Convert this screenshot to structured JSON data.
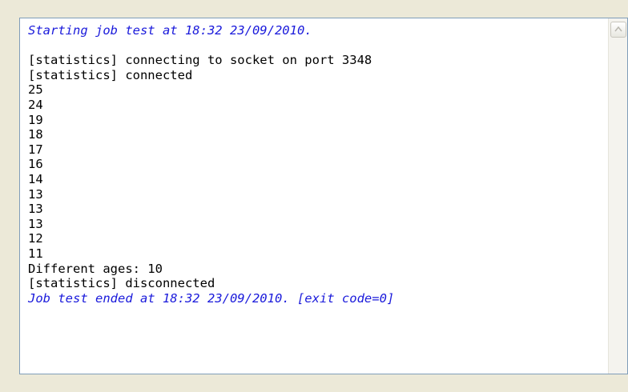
{
  "console": {
    "lines": [
      {
        "text": "Starting job test at 18:32 23/09/2010.",
        "style": "italic-blue"
      },
      {
        "text": "",
        "style": "normal"
      },
      {
        "text": "[statistics] connecting to socket on port 3348",
        "style": "normal"
      },
      {
        "text": "[statistics] connected",
        "style": "normal"
      },
      {
        "text": "25",
        "style": "normal"
      },
      {
        "text": "24",
        "style": "normal"
      },
      {
        "text": "19",
        "style": "normal"
      },
      {
        "text": "18",
        "style": "normal"
      },
      {
        "text": "17",
        "style": "normal"
      },
      {
        "text": "16",
        "style": "normal"
      },
      {
        "text": "14",
        "style": "normal"
      },
      {
        "text": "13",
        "style": "normal"
      },
      {
        "text": "13",
        "style": "normal"
      },
      {
        "text": "13",
        "style": "normal"
      },
      {
        "text": "12",
        "style": "normal"
      },
      {
        "text": "11",
        "style": "normal"
      },
      {
        "text": "Different ages: 10",
        "style": "normal"
      },
      {
        "text": "[statistics] disconnected",
        "style": "normal"
      },
      {
        "text": "Job test ended at 18:32 23/09/2010. [exit code=0]",
        "style": "italic-blue"
      }
    ]
  },
  "colors": {
    "system_text": "#1a1adb",
    "normal_text": "#000000",
    "background": "#ffffff"
  },
  "icons": {
    "scroll_up": "triangle-up-icon"
  }
}
